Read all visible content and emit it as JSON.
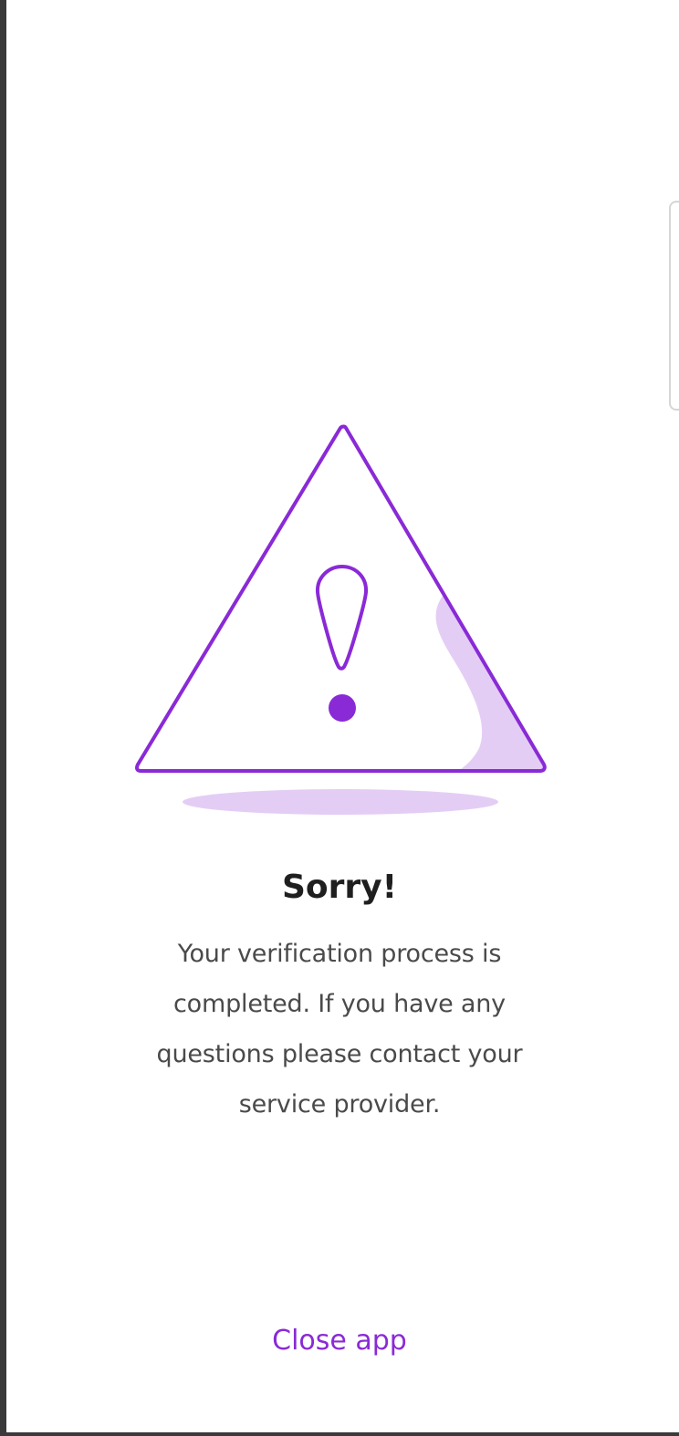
{
  "dialog": {
    "title": "Sorry!",
    "message": "Your verification process is completed. If you have any questions please contact your service provider."
  },
  "actions": {
    "close_label": "Close app"
  },
  "colors": {
    "accent": "#8a2ad6",
    "accent_light": "#e4cdf5",
    "title_text": "#1f1f1f",
    "body_text": "#4a4a4a"
  },
  "icons": {
    "illustration": "warning-triangle-icon"
  }
}
